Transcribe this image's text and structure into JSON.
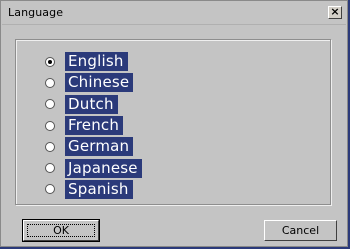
{
  "window": {
    "title": "Language",
    "close_glyph": "×"
  },
  "languages": [
    {
      "label": "English",
      "checked": true
    },
    {
      "label": "Chinese",
      "checked": false
    },
    {
      "label": "Dutch",
      "checked": false
    },
    {
      "label": "French",
      "checked": false
    },
    {
      "label": "German",
      "checked": false
    },
    {
      "label": "Japanese",
      "checked": false
    },
    {
      "label": "Spanish",
      "checked": false
    }
  ],
  "buttons": {
    "ok_label": "OK",
    "cancel_label": "Cancel"
  },
  "colors": {
    "dialog_bg": "#c4c4c4",
    "label_highlight": "#2b3a7a",
    "label_text": "#ffffff"
  }
}
